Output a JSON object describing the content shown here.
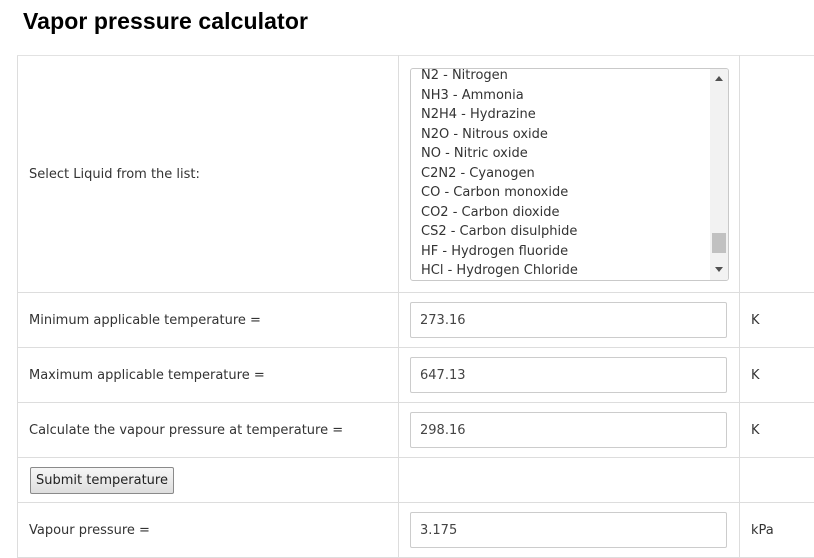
{
  "page": {
    "title": "Vapor pressure calculator"
  },
  "liquid_select": {
    "label": "Select Liquid from the list:",
    "options": [
      "N2 - Nitrogen",
      "NH3 - Ammonia",
      "N2H4 - Hydrazine",
      "N2O - Nitrous oxide",
      "NO - Nitric oxide",
      "C2N2 - Cyanogen",
      "CO - Carbon monoxide",
      "CO2 - Carbon dioxide",
      "CS2 - Carbon disulphide",
      "HF - Hydrogen fluoride",
      "HCl - Hydrogen Chloride"
    ]
  },
  "min_temp": {
    "label": "Minimum applicable temperature =",
    "value": "273.16",
    "unit": "K"
  },
  "max_temp": {
    "label": "Maximum applicable temperature =",
    "value": "647.13",
    "unit": "K"
  },
  "calc_temp": {
    "label": "Calculate the vapour pressure at temperature =",
    "value": "298.16",
    "unit": "K"
  },
  "submit": {
    "label": "Submit temperature"
  },
  "result": {
    "label": "Vapour pressure =",
    "value": "3.175",
    "unit": "kPa"
  }
}
